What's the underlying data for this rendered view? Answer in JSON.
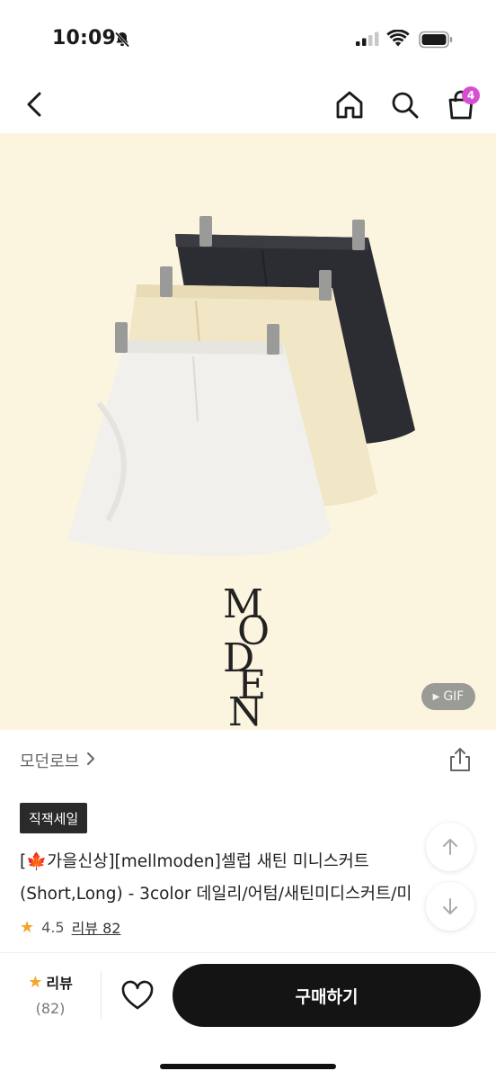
{
  "status_bar": {
    "time": "10:09"
  },
  "nav": {
    "cart_count": "4"
  },
  "product_image": {
    "brand_logo_letters": [
      "M",
      "O",
      "D",
      "E",
      "N"
    ],
    "gif_label": "GIF",
    "colors": {
      "background": "#fbf4df",
      "skirt_black": "#2b2d33",
      "skirt_cream": "#f1e6c6",
      "skirt_white": "#f1f0ec"
    }
  },
  "shop": {
    "name": "모던로브",
    "chevron": "›"
  },
  "product": {
    "sale_badge": "직잭세일",
    "title_line1": "[🍁가을신상][mellmoden]셀럽 새틴 미니스커트",
    "title_line2": "(Short,Long) - 3color 데일리/어텀/새틴미디스커트/미",
    "rating": "4.5",
    "review_label": "리뷰 82"
  },
  "bottom_bar": {
    "review_title": "리뷰",
    "review_count": "(82)",
    "buy_label": "구매하기"
  },
  "colors": {
    "accent_badge": "#d64fd1",
    "star": "#f2a527",
    "buy_button": "#141414"
  }
}
